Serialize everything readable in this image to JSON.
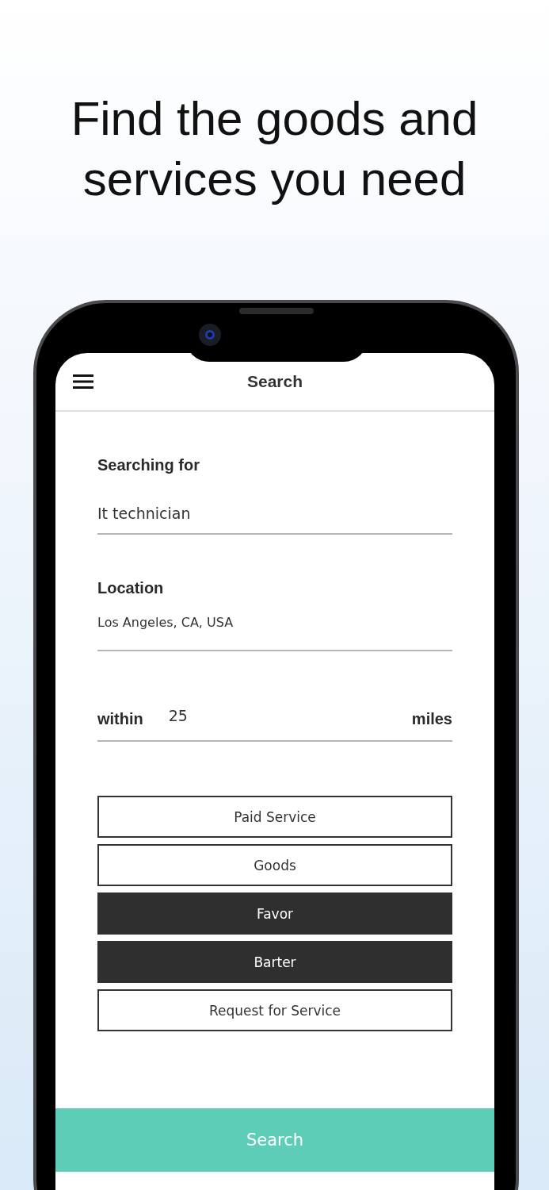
{
  "headline": "Find the goods and services you need",
  "app_bar": {
    "title": "Search"
  },
  "searching_for": {
    "label": "Searching for",
    "value": "It technician"
  },
  "location": {
    "label": "Location",
    "value": "Los Angeles, CA, USA"
  },
  "radius": {
    "prefix": "within",
    "value": "25",
    "suffix": "miles"
  },
  "options": [
    {
      "label": "Paid Service",
      "selected": false
    },
    {
      "label": "Goods",
      "selected": false
    },
    {
      "label": "Favor",
      "selected": true
    },
    {
      "label": "Barter",
      "selected": true
    },
    {
      "label": "Request for Service",
      "selected": false
    }
  ],
  "search_button": "Search"
}
